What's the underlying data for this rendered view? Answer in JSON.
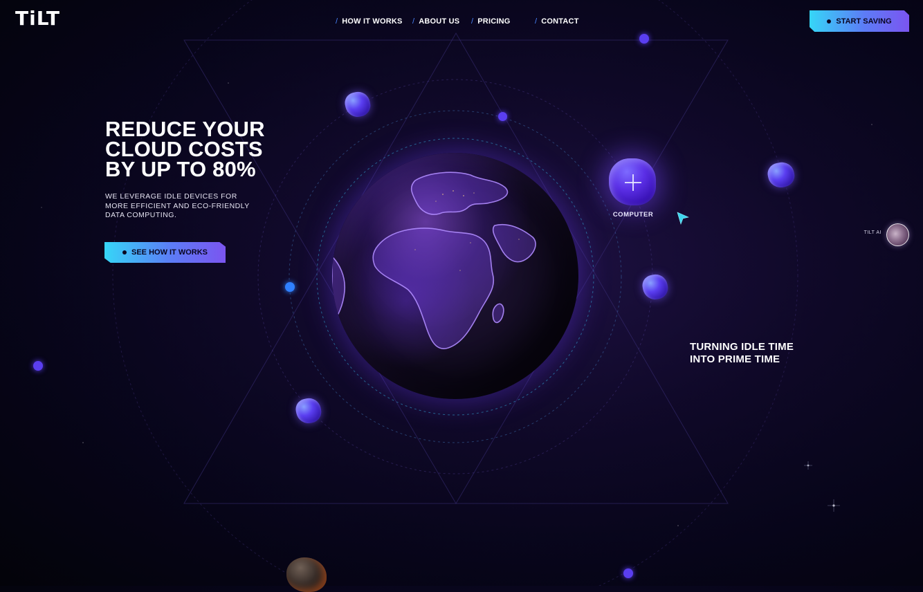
{
  "brand": {
    "logo": "TiLT"
  },
  "nav": {
    "items": [
      {
        "label": "HOW IT WORKS"
      },
      {
        "label": "ABOUT US"
      },
      {
        "label": "PRICING"
      },
      {
        "label": "CONTACT"
      }
    ],
    "separator": "/",
    "cta_label": "START SAVING"
  },
  "hero": {
    "title_lines": [
      "REDUCE YOUR",
      "CLOUD COSTS",
      "BY UP TO 80%"
    ],
    "subtitle_lines": [
      "WE LEVERAGE IDLE DEVICES FOR",
      "MORE EFFICIENT AND ECO-FRIENDLY",
      "DATA COMPUTING."
    ],
    "cta_label": "SEE HOW IT WORKS"
  },
  "visual": {
    "node_label": "COMPUTER",
    "tagline_lines": [
      "TURNING IDLE TIME",
      "INTO PRIME TIME"
    ]
  },
  "assistant": {
    "label": "TILT AI"
  },
  "colors": {
    "accent_start": "#36d6f7",
    "accent_end": "#7b55f0",
    "orbit_dot": "#5a3ef0",
    "orbit_dot_blue": "#2f80ff",
    "background": "#0e0826"
  },
  "icons": {
    "cta_dot": "dot-icon",
    "node_plus": "plus-icon",
    "pointer": "cursor-pointer-icon"
  }
}
